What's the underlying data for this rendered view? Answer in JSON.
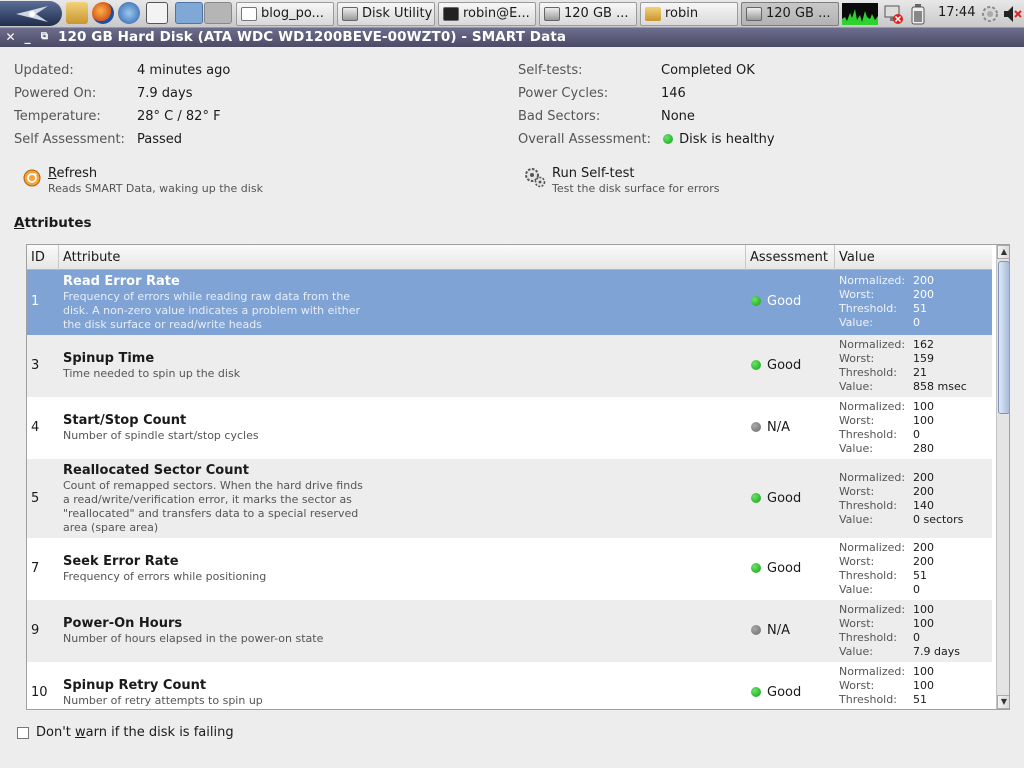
{
  "taskbar": {
    "tasks": [
      {
        "label": "blog_po..."
      },
      {
        "label": "Disk Utility"
      },
      {
        "label": "robin@E..."
      },
      {
        "label": "120 GB ..."
      },
      {
        "label": "robin"
      },
      {
        "label": "120 GB ..."
      }
    ],
    "clock": "17:44"
  },
  "window": {
    "title": "120 GB Hard Disk (ATA WDC WD1200BEVE-00WZT0) - SMART Data"
  },
  "summary": {
    "left": [
      {
        "label": "Updated:",
        "value": "4 minutes ago"
      },
      {
        "label": "Powered On:",
        "value": "7.9 days"
      },
      {
        "label": "Temperature:",
        "value": "28° C / 82° F"
      },
      {
        "label": "Self Assessment:",
        "value": "Passed"
      }
    ],
    "right": [
      {
        "label": "Self-tests:",
        "value": "Completed OK"
      },
      {
        "label": "Power Cycles:",
        "value": "146"
      },
      {
        "label": "Bad Sectors:",
        "value": "None"
      },
      {
        "label": "Overall Assessment:",
        "value": "Disk is healthy"
      }
    ]
  },
  "actions": {
    "refresh": {
      "title_first": "R",
      "title_rest": "efresh",
      "desc": "Reads SMART Data, waking up the disk"
    },
    "selftest": {
      "title": "Run Self-test",
      "desc": "Test the disk surface for errors"
    }
  },
  "attributes": {
    "heading_first": "A",
    "heading_rest": "ttributes",
    "columns": {
      "id": "ID",
      "attribute": "Attribute",
      "assessment": "Assessment",
      "value": "Value"
    },
    "value_labels": {
      "normalized": "Normalized:",
      "worst": "Worst:",
      "threshold": "Threshold:",
      "value": "Value:"
    },
    "rows": [
      {
        "id": "1",
        "name": "Read Error Rate",
        "desc": "Frequency of errors while reading raw data from the disk. A non-zero value indicates a problem with either the disk surface or read/write heads",
        "assessment": "Good",
        "status": "good",
        "normalized": "200",
        "worst": "200",
        "threshold": "51",
        "value": "0"
      },
      {
        "id": "3",
        "name": "Spinup Time",
        "desc": "Time needed to spin up the disk",
        "assessment": "Good",
        "status": "good",
        "normalized": "162",
        "worst": "159",
        "threshold": "21",
        "value": "858 msec"
      },
      {
        "id": "4",
        "name": "Start/Stop Count",
        "desc": "Number of spindle start/stop cycles",
        "assessment": "N/A",
        "status": "na",
        "normalized": "100",
        "worst": "100",
        "threshold": "0",
        "value": "280"
      },
      {
        "id": "5",
        "name": "Reallocated Sector Count",
        "desc": "Count of remapped sectors. When the hard drive finds a read/write/verification error, it marks the sector as \"reallocated\" and transfers data to a special reserved area (spare area)",
        "assessment": "Good",
        "status": "good",
        "normalized": "200",
        "worst": "200",
        "threshold": "140",
        "value": "0 sectors"
      },
      {
        "id": "7",
        "name": "Seek Error Rate",
        "desc": "Frequency of errors while positioning",
        "assessment": "Good",
        "status": "good",
        "normalized": "200",
        "worst": "200",
        "threshold": "51",
        "value": "0"
      },
      {
        "id": "9",
        "name": "Power-On Hours",
        "desc": "Number of hours elapsed in the power-on state",
        "assessment": "N/A",
        "status": "na",
        "normalized": "100",
        "worst": "100",
        "threshold": "0",
        "value": "7.9 days"
      },
      {
        "id": "10",
        "name": "Spinup Retry Count",
        "desc": "Number of retry attempts to spin up",
        "assessment": "Good",
        "status": "good",
        "normalized": "100",
        "worst": "100",
        "threshold": "51",
        "value": ""
      }
    ]
  },
  "footer": {
    "checkbox_label_pre": "Don't ",
    "checkbox_label_u": "w",
    "checkbox_label_post": "arn if the disk is failing",
    "checked": false
  }
}
